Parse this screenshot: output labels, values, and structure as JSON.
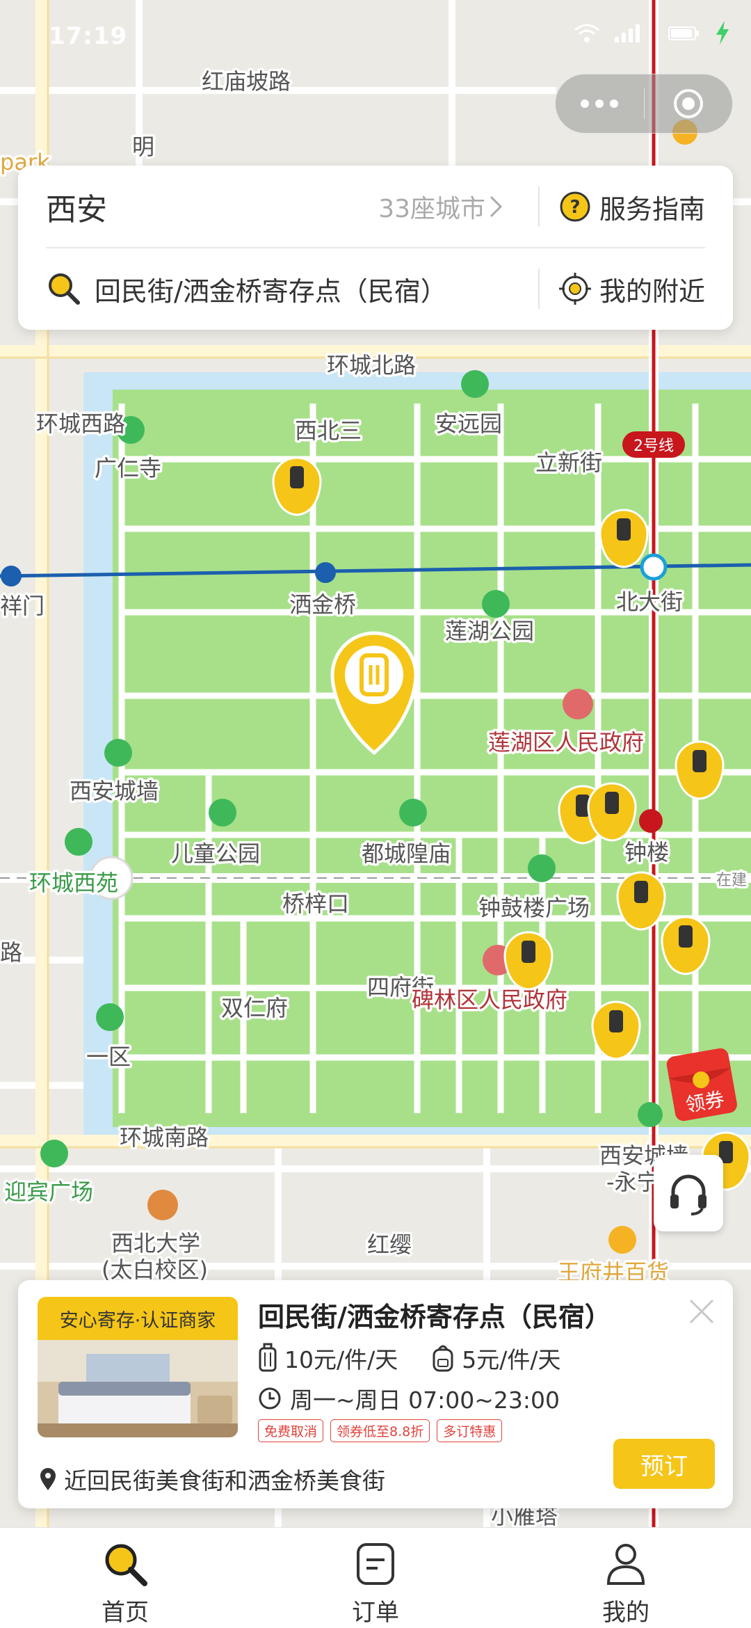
{
  "status_bar": {
    "time": "17:19"
  },
  "search_card": {
    "city": "西安",
    "city_count": "33座城市",
    "guide_label": "服务指南",
    "location_text": "回民街/洒金桥寄存点（民宿）",
    "nearby_label": "我的附近"
  },
  "map": {
    "labels": {
      "honglpolu": "红庙坡路",
      "ming": "明",
      "park": "park",
      "huanchengbeilu": "环城北路",
      "anyuanmen": "安远园",
      "guangrensi": "广仁寺",
      "xibeisan": "西北三",
      "lixinjie": "立新街",
      "line2": "2号线",
      "huanchengxilu": "环城西路",
      "xiangmen": "祥门",
      "sajinqiao": "洒金桥",
      "beidajie": "北大街",
      "lianhugongyuan": "莲湖公园",
      "lianhuquzhengfu": "莲湖区人民政府",
      "xianchengqiang": "西安城墙",
      "ertonggongyuan": "儿童公园",
      "duchenghuangmiao": "都城隍庙",
      "zhonglou": "钟楼",
      "huanchengxiyuan": "环城西苑",
      "qiaozikou": "桥梓口",
      "zhonggulouguangchang": "钟鼓楼广场",
      "lu": "路",
      "sifujie": "四府街",
      "beilinquzhengfu": "碑林区人民政府",
      "shuangrenfu": "双仁府",
      "yiqu": "一区",
      "huanchengnanlu": "环城南路",
      "yingbinguangchang": "迎宾广场",
      "xibeidaxue": "西北大学",
      "taibaixiaoqu": "(太白校区)",
      "hongying": "红缨",
      "xianchengqiang_yongning": "西安城墙",
      "yongning": "-永宁",
      "wangfujing": "王府井百货",
      "xiaoyanta": "小雁塔",
      "zaijian": "在建"
    }
  },
  "coupon": {
    "label": "领券"
  },
  "store_card": {
    "badge": "安心寄存·认证商家",
    "name": "回民街/洒金桥寄存点（民宿）",
    "price_luggage": "10元/件/天",
    "price_bag": "5元/件/天",
    "hours": "周一~周日 07:00~23:00",
    "tags": [
      "免费取消",
      "领券低至8.8折",
      "多订特惠"
    ],
    "address": "近回民街美食街和洒金桥美食街",
    "book_button": "预订"
  },
  "tab_bar": {
    "tabs": [
      {
        "label": "首页",
        "icon": "search-icon"
      },
      {
        "label": "订单",
        "icon": "order-icon"
      },
      {
        "label": "我的",
        "icon": "person-icon"
      }
    ]
  },
  "colors": {
    "accent": "#f5c518",
    "park_green": "#a7e089",
    "road": "#ffffff",
    "metro_line": "#c8161d",
    "metro_blue": "#1b5fae",
    "price_tag": "#e0433b"
  }
}
